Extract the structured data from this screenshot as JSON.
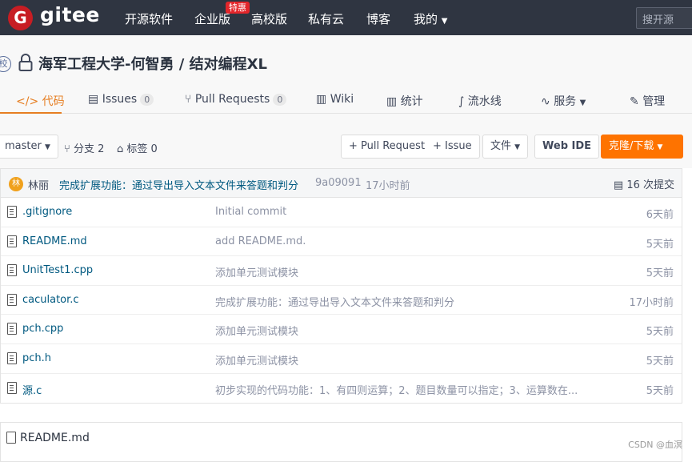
{
  "nav": {
    "logo_letter": "G",
    "logo_text": "gitee",
    "items": [
      "开源软件",
      "企业版",
      "高校版",
      "私有云",
      "博客",
      "我的"
    ],
    "hot_badge": "特惠",
    "search_placeholder": "搜开源"
  },
  "repo": {
    "badge": "校",
    "title": "海军工程大学-何智勇 / 结对编程XL"
  },
  "tabs": [
    {
      "label": "代码",
      "icon": "code-icon"
    },
    {
      "label": "Issues",
      "count": "0",
      "icon": "issues-icon"
    },
    {
      "label": "Pull Requests",
      "count": "0",
      "icon": "pull-request-icon"
    },
    {
      "label": "Wiki",
      "icon": "wiki-icon"
    },
    {
      "label": "统计",
      "icon": "stats-icon"
    },
    {
      "label": "流水线",
      "icon": "pipeline-icon"
    },
    {
      "label": "服务",
      "icon": "service-icon"
    },
    {
      "label": "管理",
      "icon": "manage-icon"
    }
  ],
  "toolbar": {
    "branch": "master",
    "branches": "分支 2",
    "tags": "标签 0",
    "pull_request": "+ Pull Request",
    "issue": "+ Issue",
    "file": "文件",
    "web_ide": "Web IDE",
    "clone": "克隆/下载"
  },
  "commit": {
    "avatar_text": "林",
    "author": "林丽",
    "message": "完成扩展功能：通过导出导入文本文件来答题和判分",
    "hash": "9a09091",
    "time": "17小时前",
    "total": "16 次提交"
  },
  "files": [
    {
      "name": ".gitignore",
      "message": "Initial commit",
      "time": "6天前"
    },
    {
      "name": "README.md",
      "message": "add README.md.",
      "time": "5天前"
    },
    {
      "name": "UnitTest1.cpp",
      "message": "添加单元测试模块",
      "time": "5天前"
    },
    {
      "name": "caculator.c",
      "message": "完成扩展功能：通过导出导入文本文件来答题和判分",
      "time": "17小时前"
    },
    {
      "name": "pch.cpp",
      "message": "添加单元测试模块",
      "time": "5天前"
    },
    {
      "name": "pch.h",
      "message": "添加单元测试模块",
      "time": "5天前"
    },
    {
      "name": "源.c",
      "message": "初步实现的代码功能：1、有四则运算；2、题目数量可以指定；3、运算数在...",
      "time": "5天前"
    }
  ],
  "readme": {
    "title": "README.md"
  },
  "watermark": "CSDN @血溟",
  "colors": {
    "brand": "#c71d23",
    "accent": "#fe7300",
    "nav_bg": "#2f3541",
    "link": "#005980"
  }
}
